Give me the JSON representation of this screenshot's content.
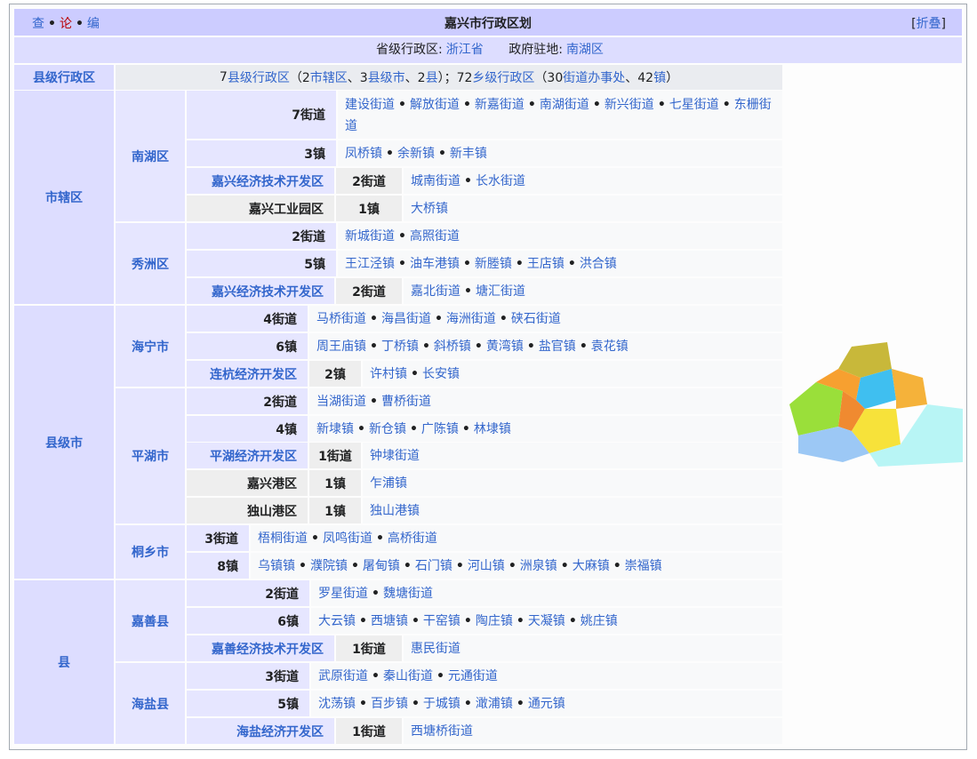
{
  "navbox": {
    "vte": {
      "view": "查",
      "talk": "论",
      "edit": "编"
    },
    "title": "嘉兴市行政区划",
    "fold_label": "[折叠]",
    "province_label": "省级行政区:",
    "province": "浙江省",
    "seat_label": "政府驻地:",
    "seat": "南湖区"
  },
  "summary": {
    "label": "县级行政区",
    "text_a": "7",
    "link_county": "县级行政区",
    "text_b": "（2",
    "link_district": "市辖区",
    "text_c": "、3",
    "link_city": "县级市",
    "text_d": "、2",
    "link_county2": "县",
    "text_e": "）；72",
    "link_township": "乡级行政区",
    "text_f": "（30",
    "link_subdistrict": "街道办事处",
    "text_g": "、42",
    "link_town": "镇",
    "text_h": "）"
  },
  "groups": [
    {
      "label": "市辖区"
    },
    {
      "label": "县级市"
    },
    {
      "label": "县"
    }
  ],
  "units": [
    "南湖区",
    "秀洲区",
    "海宁市",
    "平湖市",
    "桐乡市",
    "嘉善县",
    "海盐县"
  ],
  "rows": [
    {
      "k": "7街道",
      "items": [
        "建设街道",
        "解放街道",
        "新嘉街道",
        "南湖街道",
        "新兴街道",
        "七星街道",
        "东栅街道"
      ]
    },
    {
      "k": "3镇",
      "items": [
        "凤桥镇",
        "余新镇",
        "新丰镇"
      ]
    },
    {
      "sub": "嘉兴经济技术开发区",
      "k": "2街道",
      "items": [
        "城南街道",
        "长水街道"
      ]
    },
    {
      "sub": "嘉兴工业园区",
      "k": "1镇",
      "items": [
        "大桥镇"
      ]
    },
    {
      "k": "2街道",
      "items": [
        "新城街道",
        "高照街道"
      ]
    },
    {
      "k": "5镇",
      "items": [
        "王江泾镇",
        "油车港镇",
        "新塍镇",
        "王店镇",
        "洪合镇"
      ]
    },
    {
      "sub": "嘉兴经济技术开发区",
      "k": "2街道",
      "items": [
        "嘉北街道",
        "塘汇街道"
      ]
    },
    {
      "k": "4街道",
      "items": [
        "马桥街道",
        "海昌街道",
        "海洲街道",
        "硖石街道"
      ]
    },
    {
      "k": "6镇",
      "items": [
        "周王庙镇",
        "丁桥镇",
        "斜桥镇",
        "黄湾镇",
        "盐官镇",
        "袁花镇"
      ]
    },
    {
      "sub": "连杭经济开发区",
      "k": "2镇",
      "items": [
        "许村镇",
        "长安镇"
      ]
    },
    {
      "k": "2街道",
      "items": [
        "当湖街道",
        "曹桥街道"
      ]
    },
    {
      "k": "4镇",
      "items": [
        "新埭镇",
        "新仓镇",
        "广陈镇",
        "林埭镇"
      ]
    },
    {
      "sub": "平湖经济开发区",
      "k": "1街道",
      "items": [
        "钟埭街道"
      ]
    },
    {
      "sub": "嘉兴港区",
      "k": "1镇",
      "items": [
        "乍浦镇"
      ]
    },
    {
      "sub": "独山港区",
      "k": "1镇",
      "items": [
        "独山港镇"
      ]
    },
    {
      "k": "3街道",
      "items": [
        "梧桐街道",
        "凤鸣街道",
        "高桥街道"
      ]
    },
    {
      "k": "8镇",
      "items": [
        "乌镇镇",
        "濮院镇",
        "屠甸镇",
        "石门镇",
        "河山镇",
        "洲泉镇",
        "大麻镇",
        "崇福镇"
      ]
    },
    {
      "k": "2街道",
      "items": [
        "罗星街道",
        "魏塘街道"
      ]
    },
    {
      "k": "6镇",
      "items": [
        "大云镇",
        "西塘镇",
        "干窑镇",
        "陶庄镇",
        "天凝镇",
        "姚庄镇"
      ]
    },
    {
      "sub": "嘉善经济技术开发区",
      "k": "1街道",
      "items": [
        "惠民街道"
      ]
    },
    {
      "k": "3街道",
      "items": [
        "武原街道",
        "秦山街道",
        "元通街道"
      ]
    },
    {
      "k": "5镇",
      "items": [
        "沈荡镇",
        "百步镇",
        "于城镇",
        "澉浦镇",
        "通元镇"
      ]
    },
    {
      "sub": "海盐经济开发区",
      "k": "1街道",
      "items": [
        "西塘桥街道"
      ]
    }
  ],
  "colors": {
    "title_bg": "#ccccff",
    "group_bg": "#ddddff",
    "link": "#3366cc"
  }
}
